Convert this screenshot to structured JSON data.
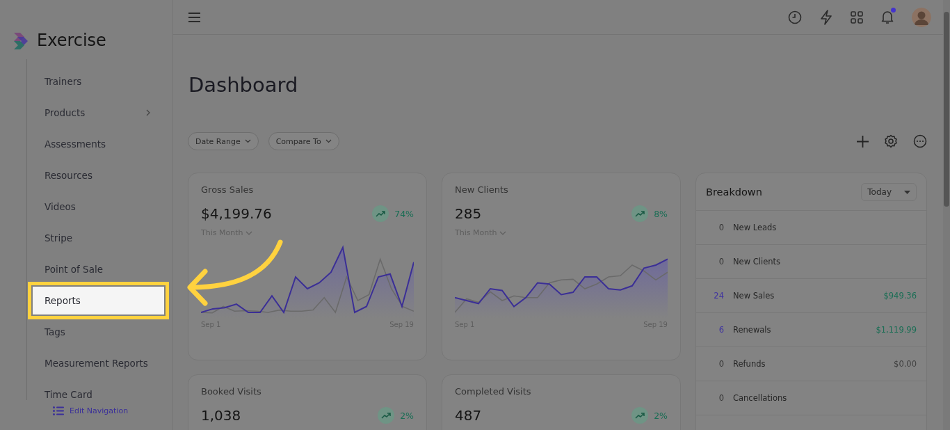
{
  "sidebar": {
    "brand": "Exercise",
    "items": [
      {
        "label": "Trainers",
        "selected": false,
        "has_submenu": false
      },
      {
        "label": "Products",
        "selected": false,
        "has_submenu": true
      },
      {
        "label": "Assessments",
        "selected": false,
        "has_submenu": false
      },
      {
        "label": "Resources",
        "selected": false,
        "has_submenu": false
      },
      {
        "label": "Videos",
        "selected": false,
        "has_submenu": false
      },
      {
        "label": "Stripe",
        "selected": false,
        "has_submenu": false
      },
      {
        "label": "Point of Sale",
        "selected": false,
        "has_submenu": false
      },
      {
        "label": "Reports",
        "selected": true,
        "has_submenu": false
      },
      {
        "label": "Tags",
        "selected": false,
        "has_submenu": false
      },
      {
        "label": "Measurement Reports",
        "selected": false,
        "has_submenu": false
      },
      {
        "label": "Time Card",
        "selected": false,
        "has_submenu": false
      }
    ],
    "edit_navigation": "Edit Navigation"
  },
  "header": {
    "notification_unread": true
  },
  "page_title": "Dashboard",
  "filters": [
    "Date Range",
    "Compare To"
  ],
  "cards": [
    {
      "title": "Gross Sales",
      "value": "$4,199.76",
      "change": "74%",
      "period": "This Month",
      "chart": {
        "start": "Sep 1",
        "end": "Sep 19"
      }
    },
    {
      "title": "New Clients",
      "value": "285",
      "change": "8%",
      "period": "This Month",
      "chart": {
        "start": "Sep 1",
        "end": "Sep 19"
      }
    },
    {
      "title": "Booked Visits",
      "value": "1,038",
      "change": "2%"
    },
    {
      "title": "Completed Visits",
      "value": "487",
      "change": "2%"
    }
  ],
  "breakdown": {
    "title": "Breakdown",
    "range": "Today",
    "rows": [
      {
        "count": "0",
        "label": "New Leads",
        "positive": false
      },
      {
        "count": "0",
        "label": "New Clients",
        "positive": false
      },
      {
        "count": "24",
        "label": "New Sales",
        "amount": "$949.36",
        "positive": true
      },
      {
        "count": "6",
        "label": "Renewals",
        "amount": "$1,119.99",
        "positive": true
      },
      {
        "count": "0",
        "label": "Refunds",
        "amount": "$0.00",
        "positive": false
      },
      {
        "count": "0",
        "label": "Cancellations",
        "positive": false
      }
    ]
  }
}
